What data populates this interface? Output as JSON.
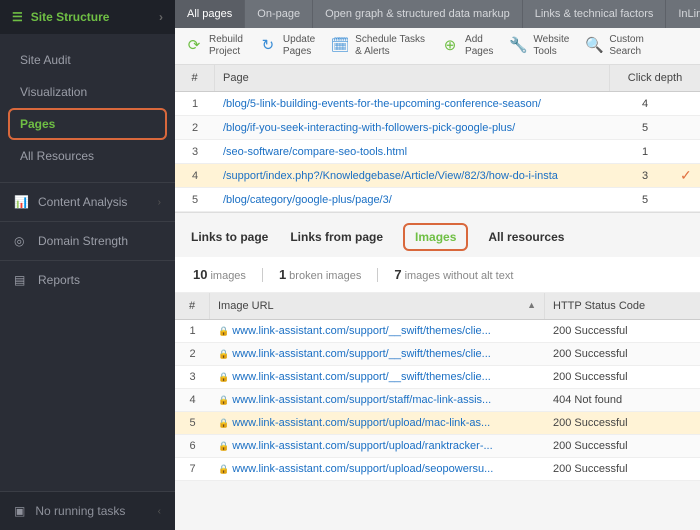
{
  "sidebar": {
    "header": "Site Structure",
    "items": [
      "Site Audit",
      "Visualization",
      "Pages",
      "All Resources"
    ],
    "active_index": 2,
    "sections": [
      {
        "label": "Content Analysis"
      },
      {
        "label": "Domain Strength"
      },
      {
        "label": "Reports"
      }
    ],
    "footer": "No running tasks"
  },
  "toptabs": [
    "All pages",
    "On-page",
    "Open graph & structured data markup",
    "Links & technical factors",
    "InLink Rank"
  ],
  "toptabs_active": 0,
  "toolbar": [
    {
      "l1": "Rebuild",
      "l2": "Project"
    },
    {
      "l1": "Update",
      "l2": "Pages"
    },
    {
      "l1": "Schedule Tasks",
      "l2": "& Alerts"
    },
    {
      "l1": "Add",
      "l2": "Pages"
    },
    {
      "l1": "Website",
      "l2": "Tools"
    },
    {
      "l1": "Custom",
      "l2": "Search"
    }
  ],
  "grid": {
    "col_num": "#",
    "col_page": "Page",
    "col_depth": "Click depth",
    "rows": [
      {
        "n": "1",
        "page": "/blog/5-link-building-events-for-the-upcoming-conference-season/",
        "depth": "4",
        "sel": false
      },
      {
        "n": "2",
        "page": "/blog/if-you-seek-interacting-with-followers-pick-google-plus/",
        "depth": "5",
        "sel": false
      },
      {
        "n": "3",
        "page": "/seo-software/compare-seo-tools.html",
        "depth": "1",
        "sel": false
      },
      {
        "n": "4",
        "page": "/support/index.php?/Knowledgebase/Article/View/82/3/how-do-i-insta",
        "depth": "3",
        "sel": true
      },
      {
        "n": "5",
        "page": "/blog/category/google-plus/page/3/",
        "depth": "5",
        "sel": false
      }
    ]
  },
  "subtabs": [
    "Links to page",
    "Links from page",
    "Images",
    "All resources"
  ],
  "subtabs_active": 2,
  "stats": {
    "count": "10",
    "count_label": "images",
    "broken": "1",
    "broken_label": "broken images",
    "noalt": "7",
    "noalt_label": "images without alt text"
  },
  "imggrid": {
    "col_num": "#",
    "col_url": "Image URL",
    "col_status": "HTTP Status Code",
    "rows": [
      {
        "n": "1",
        "url": "www.link-assistant.com/support/__swift/themes/clie...",
        "status": "200 Successful",
        "sel": false
      },
      {
        "n": "2",
        "url": "www.link-assistant.com/support/__swift/themes/clie...",
        "status": "200 Successful",
        "sel": false
      },
      {
        "n": "3",
        "url": "www.link-assistant.com/support/__swift/themes/clie...",
        "status": "200 Successful",
        "sel": false
      },
      {
        "n": "4",
        "url": "www.link-assistant.com/support/staff/mac-link-assis...",
        "status": "404 Not found",
        "sel": false
      },
      {
        "n": "5",
        "url": "www.link-assistant.com/support/upload/mac-link-as...",
        "status": "200 Successful",
        "sel": true
      },
      {
        "n": "6",
        "url": "www.link-assistant.com/support/upload/ranktracker-...",
        "status": "200 Successful",
        "sel": false
      },
      {
        "n": "7",
        "url": "www.link-assistant.com/support/upload/seopowersu...",
        "status": "200 Successful",
        "sel": false
      }
    ]
  }
}
